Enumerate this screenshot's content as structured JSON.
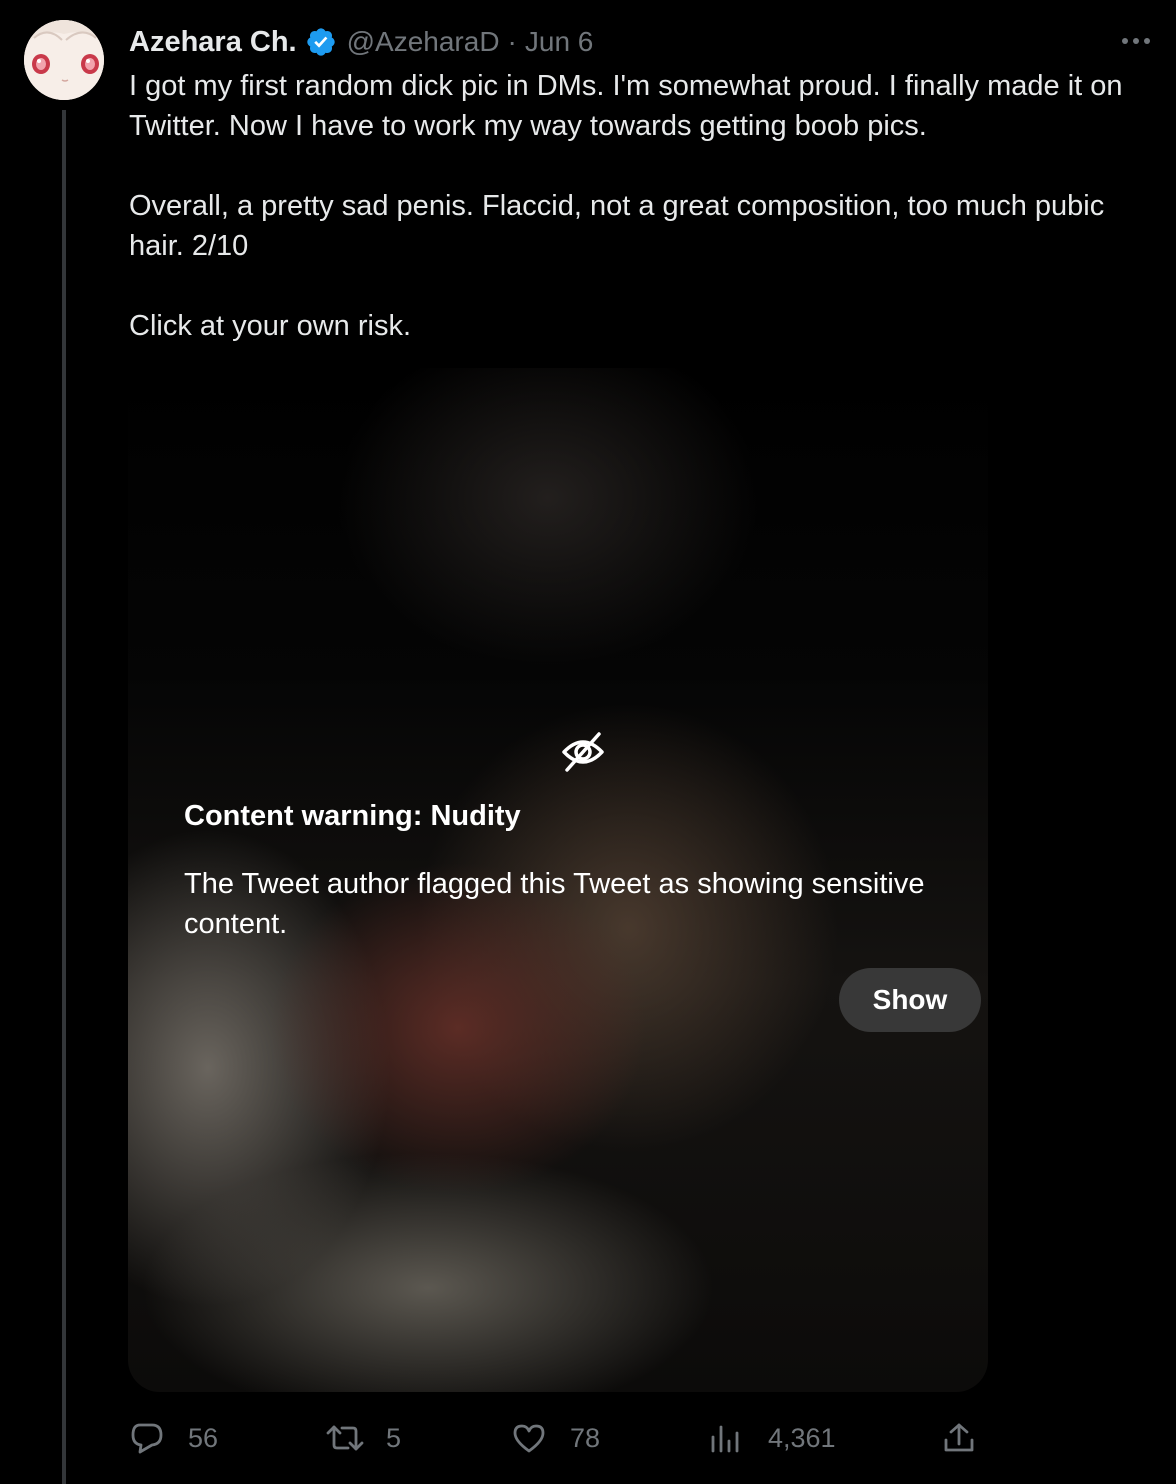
{
  "tweet": {
    "display_name": "Azehara Ch.",
    "handle": "@AzeharaD",
    "separator": "·",
    "date": "Jun 6",
    "paragraphs": [
      "I got my first random dick pic in DMs.  I'm somewhat proud.  I finally made it on Twitter.  Now I have to work my way towards getting boob pics.",
      "Overall, a pretty sad penis.  Flaccid, not a great composition, too much pubic hair.  2/10",
      "Click at your own risk."
    ]
  },
  "media": {
    "warning_title": "Content warning: Nudity",
    "warning_description": "The Tweet author flagged this Tweet as showing sensitive content.",
    "show_label": "Show"
  },
  "actions": {
    "replies": "56",
    "retweets": "5",
    "likes": "78",
    "views": "4,361"
  },
  "icons": {
    "verified": "verified-badge-icon",
    "more": "more-icon",
    "eye_slash": "eye-slash-icon",
    "reply": "reply-icon",
    "retweet": "retweet-icon",
    "like": "heart-icon",
    "views": "views-icon",
    "share": "share-icon"
  },
  "colors": {
    "background": "#000000",
    "text": "#e7e9ea",
    "muted": "#71767b",
    "verified": "#1d9bf0",
    "show_button_bg": "#3c3c3c"
  }
}
